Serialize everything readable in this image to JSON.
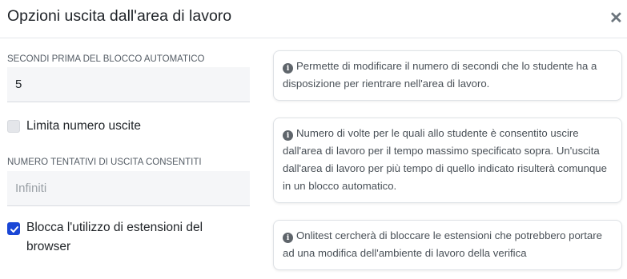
{
  "dialog": {
    "title": "Opzioni uscita dall'area di lavoro",
    "close_icon": "close-icon"
  },
  "auto_block": {
    "label": "SECONDI PRIMA DEL BLOCCO AUTOMATICO",
    "value": "5",
    "help": "Permette di modificare il numero di secondi che lo studente ha a disposizione per rientrare nell'area di lavoro."
  },
  "limit_exits": {
    "label": "Limita numero uscite",
    "checked": false,
    "help": "Numero di volte per le quali allo studente è consentito uscire dall'area di lavoro per il tempo massimo specificato sopra. Un'uscita dall'area di lavoro per più tempo di quello indicato risulterà comunque in un blocco automatico."
  },
  "exit_attempts": {
    "label": "NUMERO TENTATIVI DI USCITA CONSENTITI",
    "placeholder": "Infiniti",
    "value": ""
  },
  "block_extensions": {
    "label": "Blocca l'utilizzo di estensioni del browser",
    "checked": true,
    "help": "Onlitest cercherà di bloccare le estensioni che potrebbero portare ad una modifica dell'ambiente di lavoro della verifica"
  },
  "colors": {
    "accent": "#1a47d6",
    "field_bg": "#f5f6f8",
    "info_icon": "#5f656b"
  }
}
